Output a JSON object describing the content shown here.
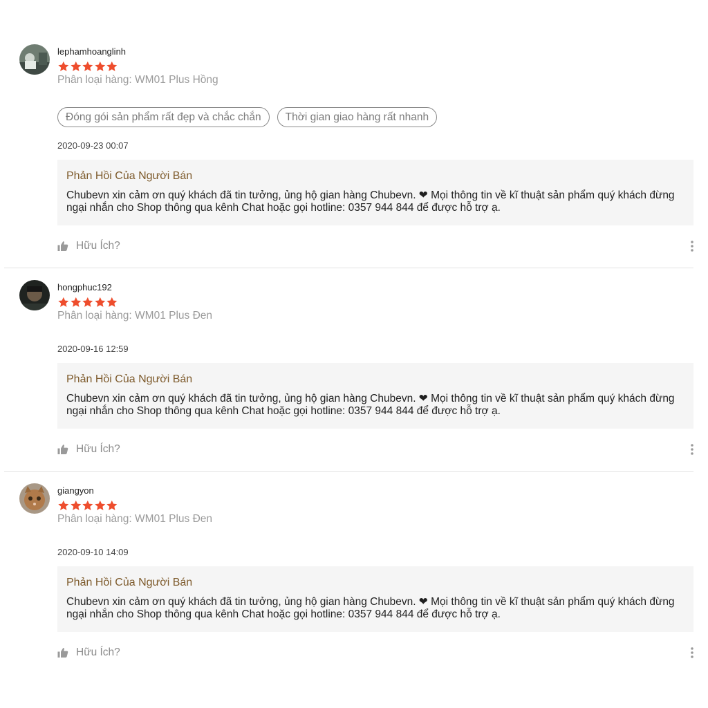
{
  "reviews": [
    {
      "username": "lephamhoanglinh",
      "rating": 5,
      "variant": "Phân loại hàng: WM01 Plus Hồng",
      "tags": [
        "Đóng gói sản phẩm rất đẹp và chắc chắn",
        "Thời gian giao hàng rất nhanh"
      ],
      "time": "2020-09-23 00:07",
      "reply_title": "Phản Hồi Của Người Bán",
      "reply_text": "Chubevn xin cảm ơn quý khách đã tin tưởng, ủng hộ gian hàng Chubevn. ❤ Mọi thông tin về kĩ thuật sản phẩm quý khách đừng ngại nhắn cho Shop thông qua kênh Chat hoặc gọi hotline: 0357 944 844 để được hỗ trợ ạ.",
      "helpful_label": "Hữu Ích?"
    },
    {
      "username": "hongphuc192",
      "rating": 5,
      "variant": "Phân loại hàng: WM01 Plus Đen",
      "tags": [],
      "time": "2020-09-16 12:59",
      "reply_title": "Phản Hồi Của Người Bán",
      "reply_text": "Chubevn xin cảm ơn quý khách đã tin tưởng, ủng hộ gian hàng Chubevn. ❤ Mọi thông tin về kĩ thuật sản phẩm quý khách đừng ngại nhắn cho Shop thông qua kênh Chat hoặc gọi hotline: 0357 944 844 để được hỗ trợ ạ.",
      "helpful_label": "Hữu Ích?"
    },
    {
      "username": "giangyon",
      "rating": 5,
      "variant": "Phân loại hàng: WM01 Plus Đen",
      "tags": [],
      "time": "2020-09-10 14:09",
      "reply_title": "Phản Hồi Của Người Bán",
      "reply_text": "Chubevn xin cảm ơn quý khách đã tin tưởng, ủng hộ gian hàng Chubevn. ❤ Mọi thông tin về kĩ thuật sản phẩm quý khách đừng ngại nhắn cho Shop thông qua kênh Chat hoặc gọi hotline: 0357 944 844 để được hỗ trợ ạ.",
      "helpful_label": "Hữu Ích?"
    }
  ],
  "icons": {
    "star": "star-icon",
    "helpful": "thumbs-up-icon",
    "more": "more-vertical-icon"
  },
  "colors": {
    "star": "#ee4d2d",
    "reply_title": "#7d5a2b",
    "reply_bg": "#f5f5f5",
    "muted": "#9a9a9a"
  }
}
